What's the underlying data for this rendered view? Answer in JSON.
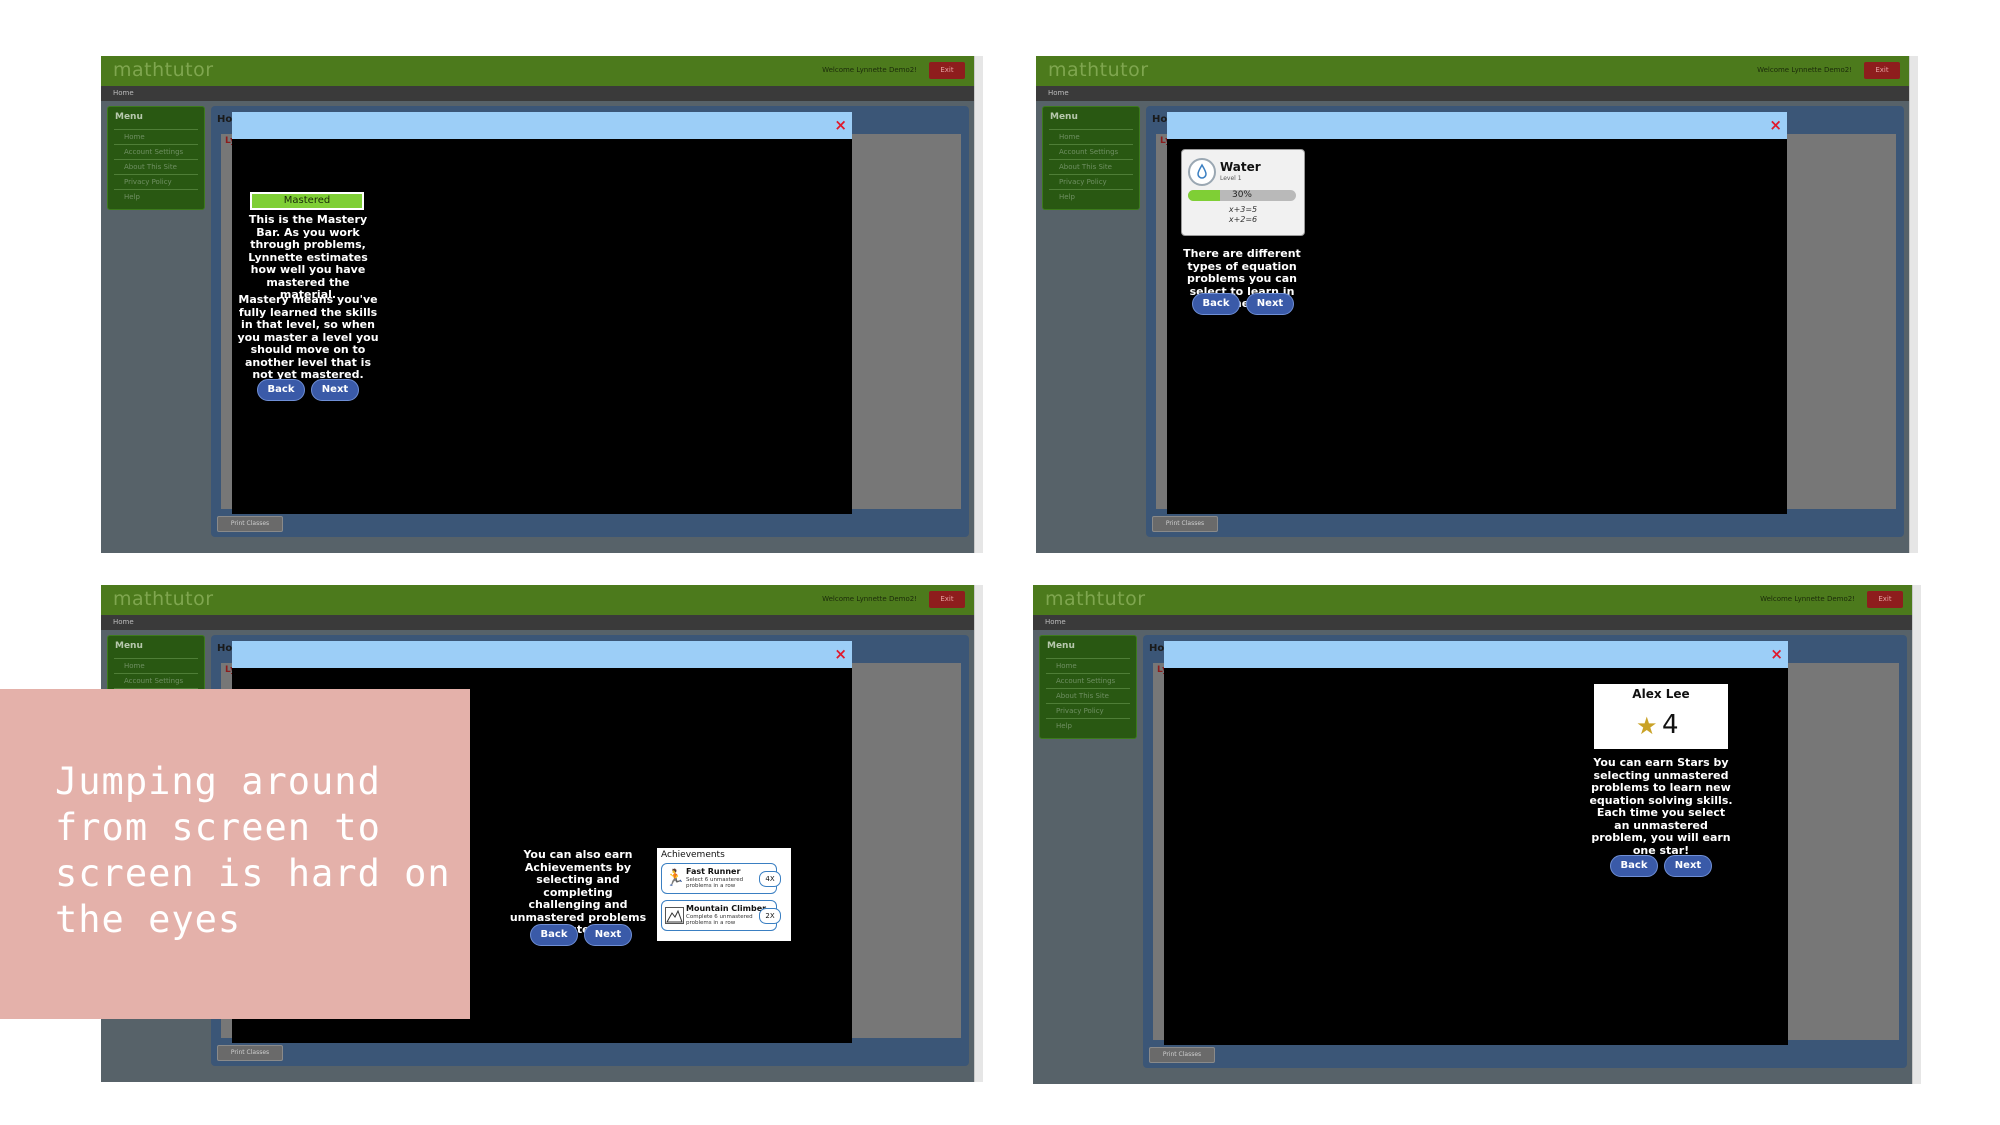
{
  "app": {
    "logo": "mathtutor",
    "welcome_s1": "Welcome Lynnette Demo2!",
    "welcome_s2": "Welcome Lynnette Demo2!",
    "welcome_s3": "Welcome Lynnette Demo2!",
    "welcome_s4": "Welcome Lynnette Demo2!",
    "exit_label": "Exit",
    "breadcrumb": "Home",
    "menu_title": "Menu",
    "menu_items": [
      "Home",
      "Account Settings",
      "About This Site",
      "Privacy Policy",
      "Help"
    ],
    "panel_title": "Ho",
    "panel_sub": "Ly",
    "panel_l": "L",
    "print_label": "Print Classes",
    "close_glyph": "×"
  },
  "buttons": {
    "back": "Back",
    "next": "Next"
  },
  "screens": {
    "mastery": {
      "bar_label": "Mastered",
      "para1": "This is the Mastery Bar. As you work through problems, Lynnette estimates how well you have mastered the material.",
      "para2": "Mastery means you've fully learned the skills in that level, so when you master a level you should move on to another level that is not yet mastered."
    },
    "levels": {
      "level_name": "Water",
      "level_sub": "Level 1",
      "progress_label": "30%",
      "progress_fraction": 0.3,
      "eq1": "x+3=5",
      "eq2": "x+2=6",
      "text": "There are different types of equation problems you can select to learn in Lynnette."
    },
    "achievements": {
      "text": "You can also earn Achievements by selecting and completing challenging and unmastered problems persistently.",
      "box_title": "Achievements",
      "items": [
        {
          "title": "Fast Runner",
          "desc": "Select 6 unmastered problems in a row",
          "count": "4X"
        },
        {
          "title": "Mountain Climber",
          "desc": "Complete 6 unmastered problems in a row",
          "count": "2X"
        }
      ]
    },
    "stars": {
      "student_name": "Alex Lee",
      "star_count": "4",
      "text": "You can earn Stars by selecting unmastered problems to learn new equation solving skills. Each time you select an unmastered problem, you will earn one star!"
    }
  },
  "overlay": {
    "text": "Jumping around from screen to screen is hard on the eyes"
  },
  "colors": {
    "accent_green": "#4c7a1c",
    "modal_header": "#9ccef7",
    "button_blue": "#3a5aa8",
    "overlay_pink": "#e4b1aa"
  }
}
